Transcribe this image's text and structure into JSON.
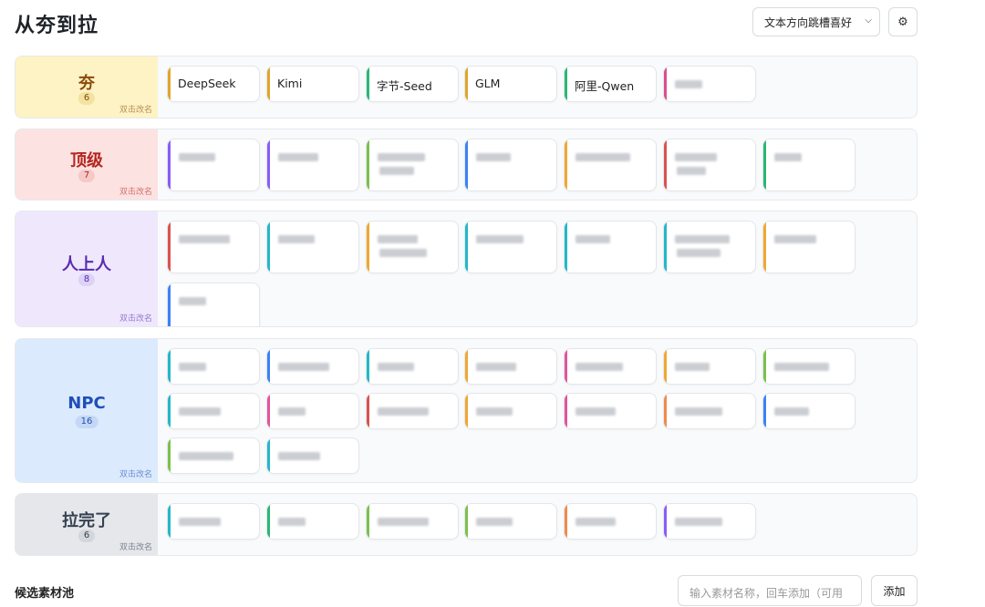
{
  "header": {
    "title": "从夯到拉",
    "preference_select": "文本方向跳槽喜好",
    "settings_icon": "gear-icon"
  },
  "tiers": [
    {
      "name": "夯",
      "count": "6",
      "hint": "双击改名",
      "bg": "#fdf3c4",
      "color": "#8a4b0a",
      "badge_bg": "#f3e2a2",
      "items": [
        {
          "label": "DeepSeek",
          "color": "#e0a62a"
        },
        {
          "label": "Kimi",
          "color": "#e0a62a"
        },
        {
          "label": "字节-Seed",
          "color": "#2bb673"
        },
        {
          "label": "GLM",
          "color": "#e0a62a"
        },
        {
          "label": "阿里-Qwen",
          "color": "#2bb673"
        },
        {
          "label": "",
          "color": "#d94f8e"
        }
      ]
    },
    {
      "name": "顶级",
      "count": "7",
      "hint": "双击改名",
      "bg": "#fde2e2",
      "color": "#b3261e",
      "badge_bg": "#f6c9c9",
      "items": [
        {
          "label": "",
          "color": "#8b5cf6"
        },
        {
          "label": "",
          "color": "#8b5cf6"
        },
        {
          "label": "",
          "color": "#7cc04d"
        },
        {
          "label": "",
          "color": "#3b82f6"
        },
        {
          "label": "",
          "color": "#f0a830"
        },
        {
          "label": "",
          "color": "#d9534f"
        },
        {
          "label": "",
          "color": "#2bb673"
        }
      ]
    },
    {
      "name": "人上人",
      "count": "8",
      "hint": "双击改名",
      "bg": "#efe8fd",
      "color": "#5b2bb0",
      "badge_bg": "#ddd2f7",
      "items": [
        {
          "label": "",
          "color": "#d9534f"
        },
        {
          "label": "",
          "color": "#22b8c8"
        },
        {
          "label": "",
          "color": "#f0a830"
        },
        {
          "label": "",
          "color": "#22b8c8"
        },
        {
          "label": "",
          "color": "#22b8c8"
        },
        {
          "label": "",
          "color": "#22b8c8"
        },
        {
          "label": "",
          "color": "#f0a830"
        },
        {
          "label": "",
          "color": "#3b82f6"
        }
      ]
    },
    {
      "name": "NPC",
      "count": "16",
      "hint": "双击改名",
      "bg": "#dceafd",
      "color": "#1f4fb8",
      "badge_bg": "#c4d8f5",
      "items": [
        {
          "label": "",
          "color": "#22b8c8"
        },
        {
          "label": "",
          "color": "#3b82f6"
        },
        {
          "label": "",
          "color": "#22b8c8"
        },
        {
          "label": "",
          "color": "#f0a830"
        },
        {
          "label": "",
          "color": "#e0559a"
        },
        {
          "label": "",
          "color": "#f0a830"
        },
        {
          "label": "",
          "color": "#7cc04d"
        },
        {
          "label": "",
          "color": "#22b8c8"
        },
        {
          "label": "",
          "color": "#e0559a"
        },
        {
          "label": "",
          "color": "#d9534f"
        },
        {
          "label": "",
          "color": "#f0a830"
        },
        {
          "label": "",
          "color": "#e0559a"
        },
        {
          "label": "",
          "color": "#f08a4b"
        },
        {
          "label": "",
          "color": "#3b82f6"
        },
        {
          "label": "",
          "color": "#7cc04d"
        },
        {
          "label": "",
          "color": "#22b8c8"
        }
      ]
    },
    {
      "name": "拉完了",
      "count": "6",
      "hint": "双击改名",
      "bg": "#e5e7eb",
      "color": "#374151",
      "badge_bg": "#d3d6db",
      "items": [
        {
          "label": "",
          "color": "#22b8c8"
        },
        {
          "label": "",
          "color": "#2bb673"
        },
        {
          "label": "",
          "color": "#7cc04d"
        },
        {
          "label": "",
          "color": "#7cc04d"
        },
        {
          "label": "",
          "color": "#f08a4b"
        },
        {
          "label": "",
          "color": "#8b5cf6"
        }
      ]
    }
  ],
  "pool": {
    "title": "候选素材池",
    "input_placeholder": "输入素材名称，回车添加（可用",
    "add_label": "添加"
  }
}
